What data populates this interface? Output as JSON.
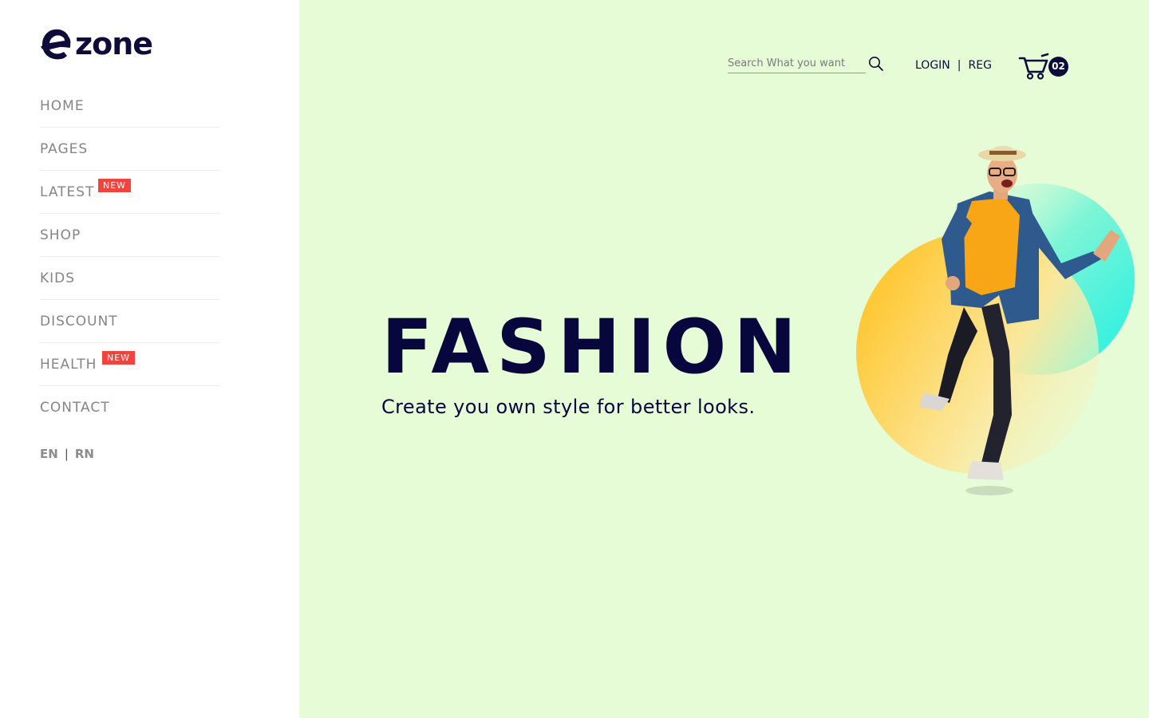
{
  "brand": {
    "name": "ezone"
  },
  "sidebar": {
    "items": [
      {
        "label": "HOME"
      },
      {
        "label": "PAGES"
      },
      {
        "label": "LATEST",
        "badge": "NEW"
      },
      {
        "label": "SHOP"
      },
      {
        "label": "KIDS"
      },
      {
        "label": "DISCOUNT"
      },
      {
        "label": "HEALTH",
        "badge": "NEW"
      },
      {
        "label": "CONTACT"
      }
    ],
    "languages": [
      "EN",
      "RN"
    ],
    "lang_separator": "|"
  },
  "header": {
    "search_placeholder": "Search What you want",
    "login_label": "LOGIN",
    "separator": "|",
    "register_label": "REG",
    "cart_count": "02"
  },
  "hero": {
    "title": "FASHION",
    "subtitle": "Create you own style for better looks."
  },
  "colors": {
    "background": "#e5fcd6",
    "sidebar": "#ffffff",
    "brand_navy": "#08073d",
    "badge_red": "#f2433c",
    "nav_text": "#858585",
    "circle_yellow": "#ffc83a",
    "circle_cyan": "#2ef2e0"
  },
  "icons": [
    "search-icon",
    "cart-icon"
  ]
}
